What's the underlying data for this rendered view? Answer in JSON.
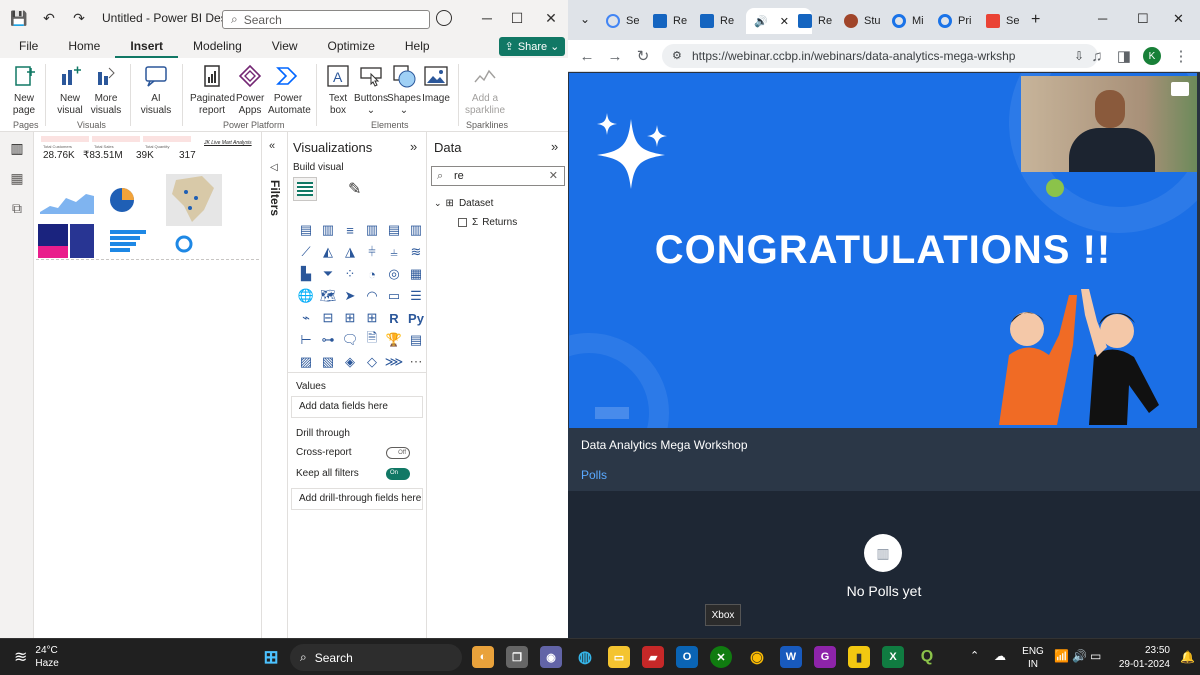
{
  "pbi": {
    "window_title": "Untitled - Power BI Desktop",
    "search_placeholder": "Search",
    "menu": [
      "File",
      "Home",
      "Insert",
      "Modeling",
      "View",
      "Optimize",
      "Help"
    ],
    "share_label": "Share",
    "ribbon": {
      "new_page": "New page",
      "new_visual": "New visual",
      "more_visuals": "More visuals",
      "ai_visuals": "AI visuals",
      "paginated_report": "Paginated report",
      "power_apps": "Power Apps",
      "power_automate": "Power Automate",
      "text_box": "Text box",
      "buttons": "Buttons",
      "shapes": "Shapes",
      "image": "Image",
      "add_sparkline": "Add a sparkline",
      "groups": {
        "pages": "Pages",
        "visuals": "Visuals",
        "power_platform": "Power Platform",
        "elements": "Elements",
        "sparklines": "Sparklines"
      }
    },
    "report": {
      "kpis": [
        {
          "label": "Total Customers",
          "value": "28.76K"
        },
        {
          "label": "Total Sales",
          "value": "₹83.51M"
        },
        {
          "label": "Total Quantity",
          "value": "39K"
        },
        {
          "label": "",
          "value": "317"
        }
      ],
      "report_title": "JK Live Mart Analysis"
    },
    "filters_label": "Filters",
    "visualizations": {
      "title": "Visualizations",
      "build_visual": "Build visual",
      "values_label": "Values",
      "values_placeholder": "Add data fields here",
      "drill_through": "Drill through",
      "cross_report": "Cross-report",
      "cross_report_state": "Off",
      "keep_all_filters": "Keep all filters",
      "keep_all_filters_state": "On",
      "drill_placeholder": "Add drill-through fields here"
    },
    "data": {
      "title": "Data",
      "search_value": "re",
      "table": "Dataset",
      "field": "Returns"
    }
  },
  "browser": {
    "tabs": [
      "Se",
      "Re",
      "Re",
      "",
      "Re",
      "Stu",
      "Mi",
      "Pri",
      "Se"
    ],
    "url": "https://webinar.ccbp.in/webinars/data-analytics-mega-wrkshp",
    "profile_initial": "K",
    "slide_text": "CONGRATULATIONS !!",
    "workshop_title": "Data Analytics Mega Workshop",
    "polls_tab": "Polls",
    "no_polls": "No Polls yet",
    "tooltip": "Xbox"
  },
  "taskbar": {
    "temperature": "24°C",
    "weather": "Haze",
    "search": "Search",
    "lang": "ENG",
    "region": "IN",
    "time": "23:50",
    "date": "29-01-2024"
  },
  "colors": {
    "pbi_accent": "#117865",
    "slide_blue": "#1b6fe6",
    "browser_dark": "#283240"
  }
}
